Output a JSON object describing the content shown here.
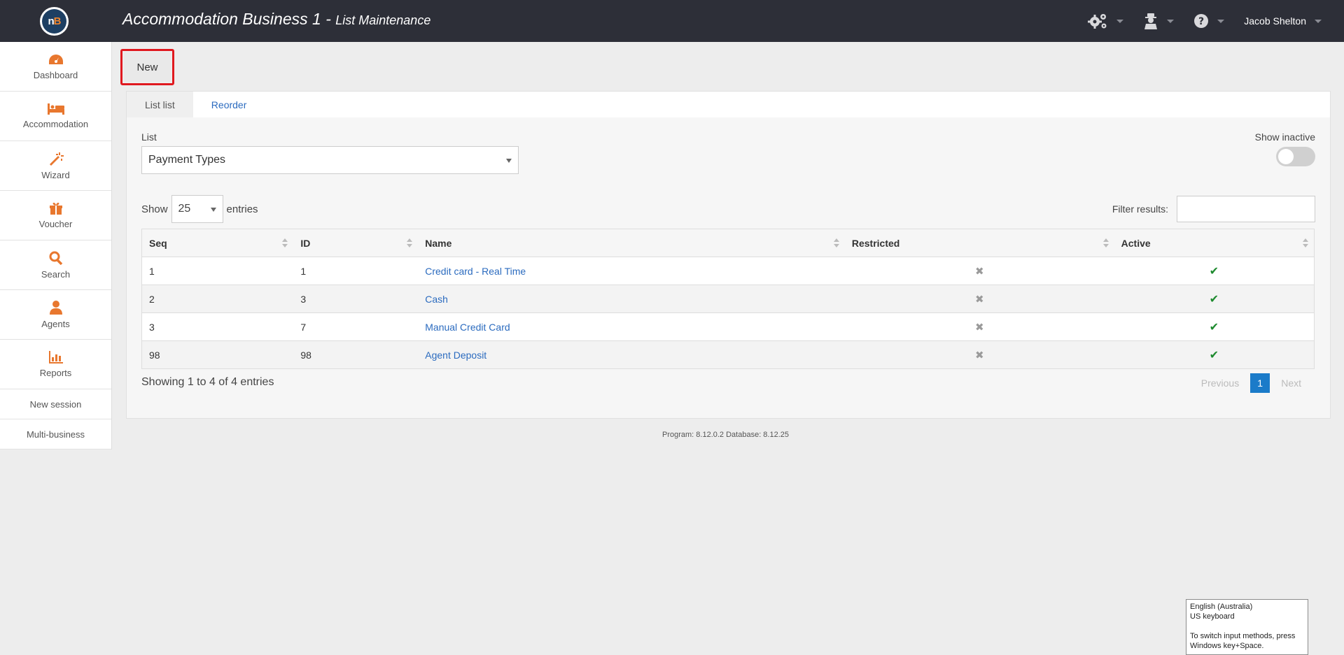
{
  "header": {
    "logo_text_n": "n",
    "logo_text_b": "B",
    "title": "Accommodation Business 1 - ",
    "subtitle": "List Maintenance",
    "user_name": "Jacob Shelton",
    "icons": [
      "gears-icon",
      "agent-icon",
      "help-icon"
    ]
  },
  "sidebar": {
    "items": [
      {
        "label": "Dashboard",
        "icon": "dashboard-icon"
      },
      {
        "label": "Accommodation",
        "icon": "bed-icon"
      },
      {
        "label": "Wizard",
        "icon": "wand-icon"
      },
      {
        "label": "Voucher",
        "icon": "gift-icon"
      },
      {
        "label": "Search",
        "icon": "search-icon"
      },
      {
        "label": "Agents",
        "icon": "user-icon"
      },
      {
        "label": "Reports",
        "icon": "bar-chart-icon"
      }
    ],
    "links": [
      "New session",
      "Multi-business"
    ]
  },
  "toolbar": {
    "new_label": "New"
  },
  "tabs": [
    {
      "label": "List list",
      "active": true
    },
    {
      "label": "Reorder",
      "active": false
    }
  ],
  "list_selector": {
    "label": "List",
    "value": "Payment Types"
  },
  "show_inactive": {
    "label": "Show inactive",
    "on": false
  },
  "entries": {
    "show_label": "Show",
    "value": "25",
    "entries_label": "entries"
  },
  "filter": {
    "label": "Filter results:",
    "value": ""
  },
  "table": {
    "columns": [
      "Seq",
      "ID",
      "Name",
      "Restricted",
      "Active"
    ],
    "rows": [
      {
        "seq": "1",
        "id": "1",
        "name": "Credit card - Real Time",
        "restricted": false,
        "active": true
      },
      {
        "seq": "2",
        "id": "3",
        "name": "Cash",
        "restricted": false,
        "active": true
      },
      {
        "seq": "3",
        "id": "7",
        "name": "Manual Credit Card",
        "restricted": false,
        "active": true
      },
      {
        "seq": "98",
        "id": "98",
        "name": "Agent Deposit",
        "restricted": false,
        "active": true
      }
    ]
  },
  "pagination": {
    "summary": "Showing 1 to 4 of 4 entries",
    "previous": "Previous",
    "current": "1",
    "next": "Next"
  },
  "footer": {
    "version": "Program: 8.12.0.2 Database: 8.12.25"
  },
  "ime_tooltip": {
    "line1": "English (Australia)",
    "line2": "US keyboard",
    "line3": "To switch input methods, press Windows key+Space."
  },
  "colors": {
    "topbar": "#2d2f38",
    "accent_orange": "#e8772e",
    "link_blue": "#2b6bbf",
    "pager_active": "#1b7bc9",
    "highlight_red": "#e0191f",
    "check_green": "#1d8a2e"
  }
}
